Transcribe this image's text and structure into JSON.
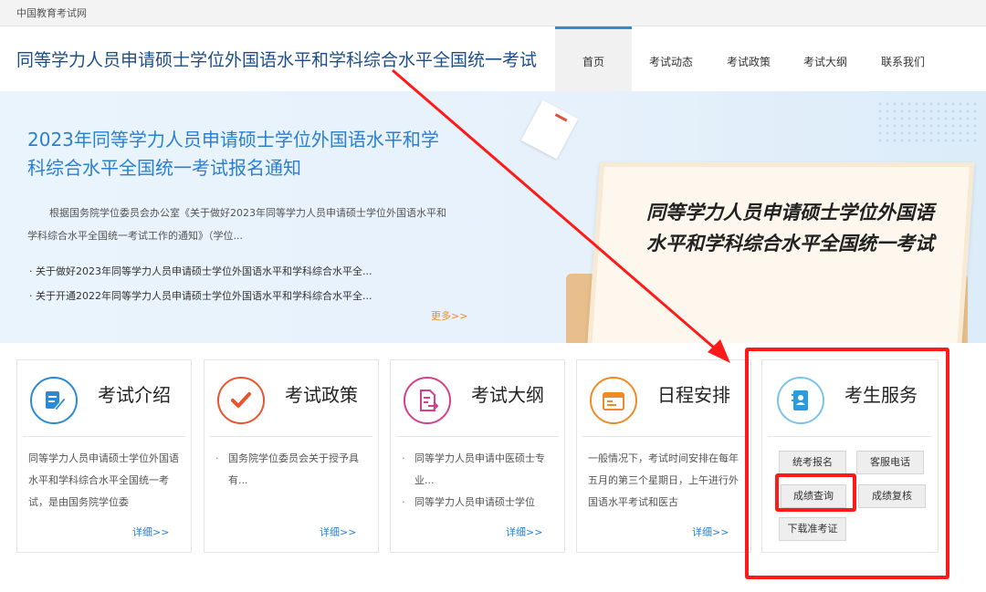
{
  "topbar": {
    "label": "中国教育考试网"
  },
  "header": {
    "site_title": "同等学力人员申请硕士学位外国语水平和学科综合水平全国统一考试",
    "nav": [
      {
        "label": "首页",
        "active": true
      },
      {
        "label": "考试动态"
      },
      {
        "label": "考试政策"
      },
      {
        "label": "考试大纲"
      },
      {
        "label": "联系我们"
      }
    ]
  },
  "banner": {
    "title": "2023年同等学力人员申请硕士学位外国语水平和学科综合水平全国统一考试报名通知",
    "summary": "根据国务院学位委员会办公室《关于做好2023年同等学力人员申请硕士学位外国语水平和学科综合水平全国统一考试工作的通知》（学位...",
    "links": [
      "· 关于做好2023年同等学力人员申请硕士学位外国语水平和学科综合水平全...",
      "· 关于开通2022年同等学力人员申请硕士学位外国语水平和学科综合水平全..."
    ],
    "more": "更多>>",
    "board_text": "同等学力人员申请硕士学位外国语水平和学科综合水平全国统一考试"
  },
  "cards": {
    "intro": {
      "title": "考试介绍",
      "body": "同等学力人员申请硕士学位外国语水平和学科综合水平全国统一考试，是由国务院学位委",
      "more": "详细>>",
      "color": "#2b8ad6"
    },
    "policy": {
      "title": "考试政策",
      "items": [
        "国务院学位委员会关于授予具有..."
      ],
      "more": "详细>>",
      "color": "#e8542f"
    },
    "outline": {
      "title": "考试大纲",
      "items": [
        "同等学力人员申请中医硕士专业...",
        "同等学力人员申请硕士学位"
      ],
      "more": "详细>>",
      "color": "#d63f8c"
    },
    "schedule": {
      "title": "日程安排",
      "body": "一般情况下，考试时间安排在每年五月的第三个星期日，上午进行外国语水平考试和医古",
      "more": "详细>>",
      "color": "#f08a24"
    }
  },
  "service": {
    "title": "考生服务",
    "buttons": {
      "register": "统考报名",
      "hotline": "客服电话",
      "score_query": "成绩查询",
      "score_review": "成绩复核",
      "admission_ticket": "下载准考证"
    }
  },
  "colors": {
    "annotation_red": "#ff1a1a",
    "brand_blue": "#2b7fd1"
  }
}
